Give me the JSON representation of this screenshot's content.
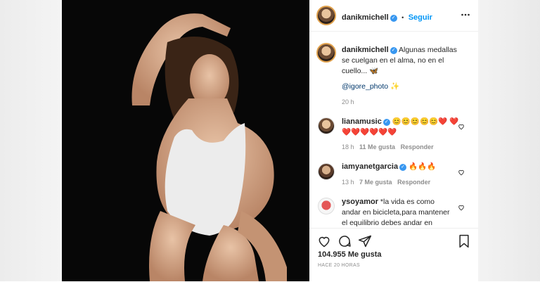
{
  "post": {
    "username": "danikmichell",
    "follow_label": "Seguir",
    "dot": "•",
    "caption_text": "Algunas medallas se cuelgan en el alma, no en el cuello...",
    "caption_emoji": "🦋",
    "mention": "@igore_photo",
    "mention_emoji": "✨",
    "caption_time": "20 h",
    "likes": "104.955 Me gusta",
    "time_ago": "HACE 20 HORAS"
  },
  "comments": [
    {
      "username": "lianamusic",
      "text": "😊😊😊😊😊❤️ ❤️❤️❤️❤️❤️❤️❤️",
      "time": "18 h",
      "likes": "11 Me gusta",
      "reply": "Responder"
    },
    {
      "username": "iamyanetgarcia",
      "text": "🔥🔥🔥",
      "time": "13 h",
      "likes": "7 Me gusta",
      "reply": "Responder"
    },
    {
      "username": "ysoyamor",
      "text": "*la vida es como andar en bicicleta,para mantener el equilibrio debes andar en"
    }
  ],
  "colors": {
    "accent": "#0095f6",
    "verified": "#3897f0",
    "text": "#262626",
    "muted": "#8e8e8e"
  },
  "icons": [
    "more-icon",
    "heart-icon",
    "comment-icon",
    "share-icon",
    "bookmark-icon",
    "chevron-right-icon",
    "verified-icon"
  ]
}
